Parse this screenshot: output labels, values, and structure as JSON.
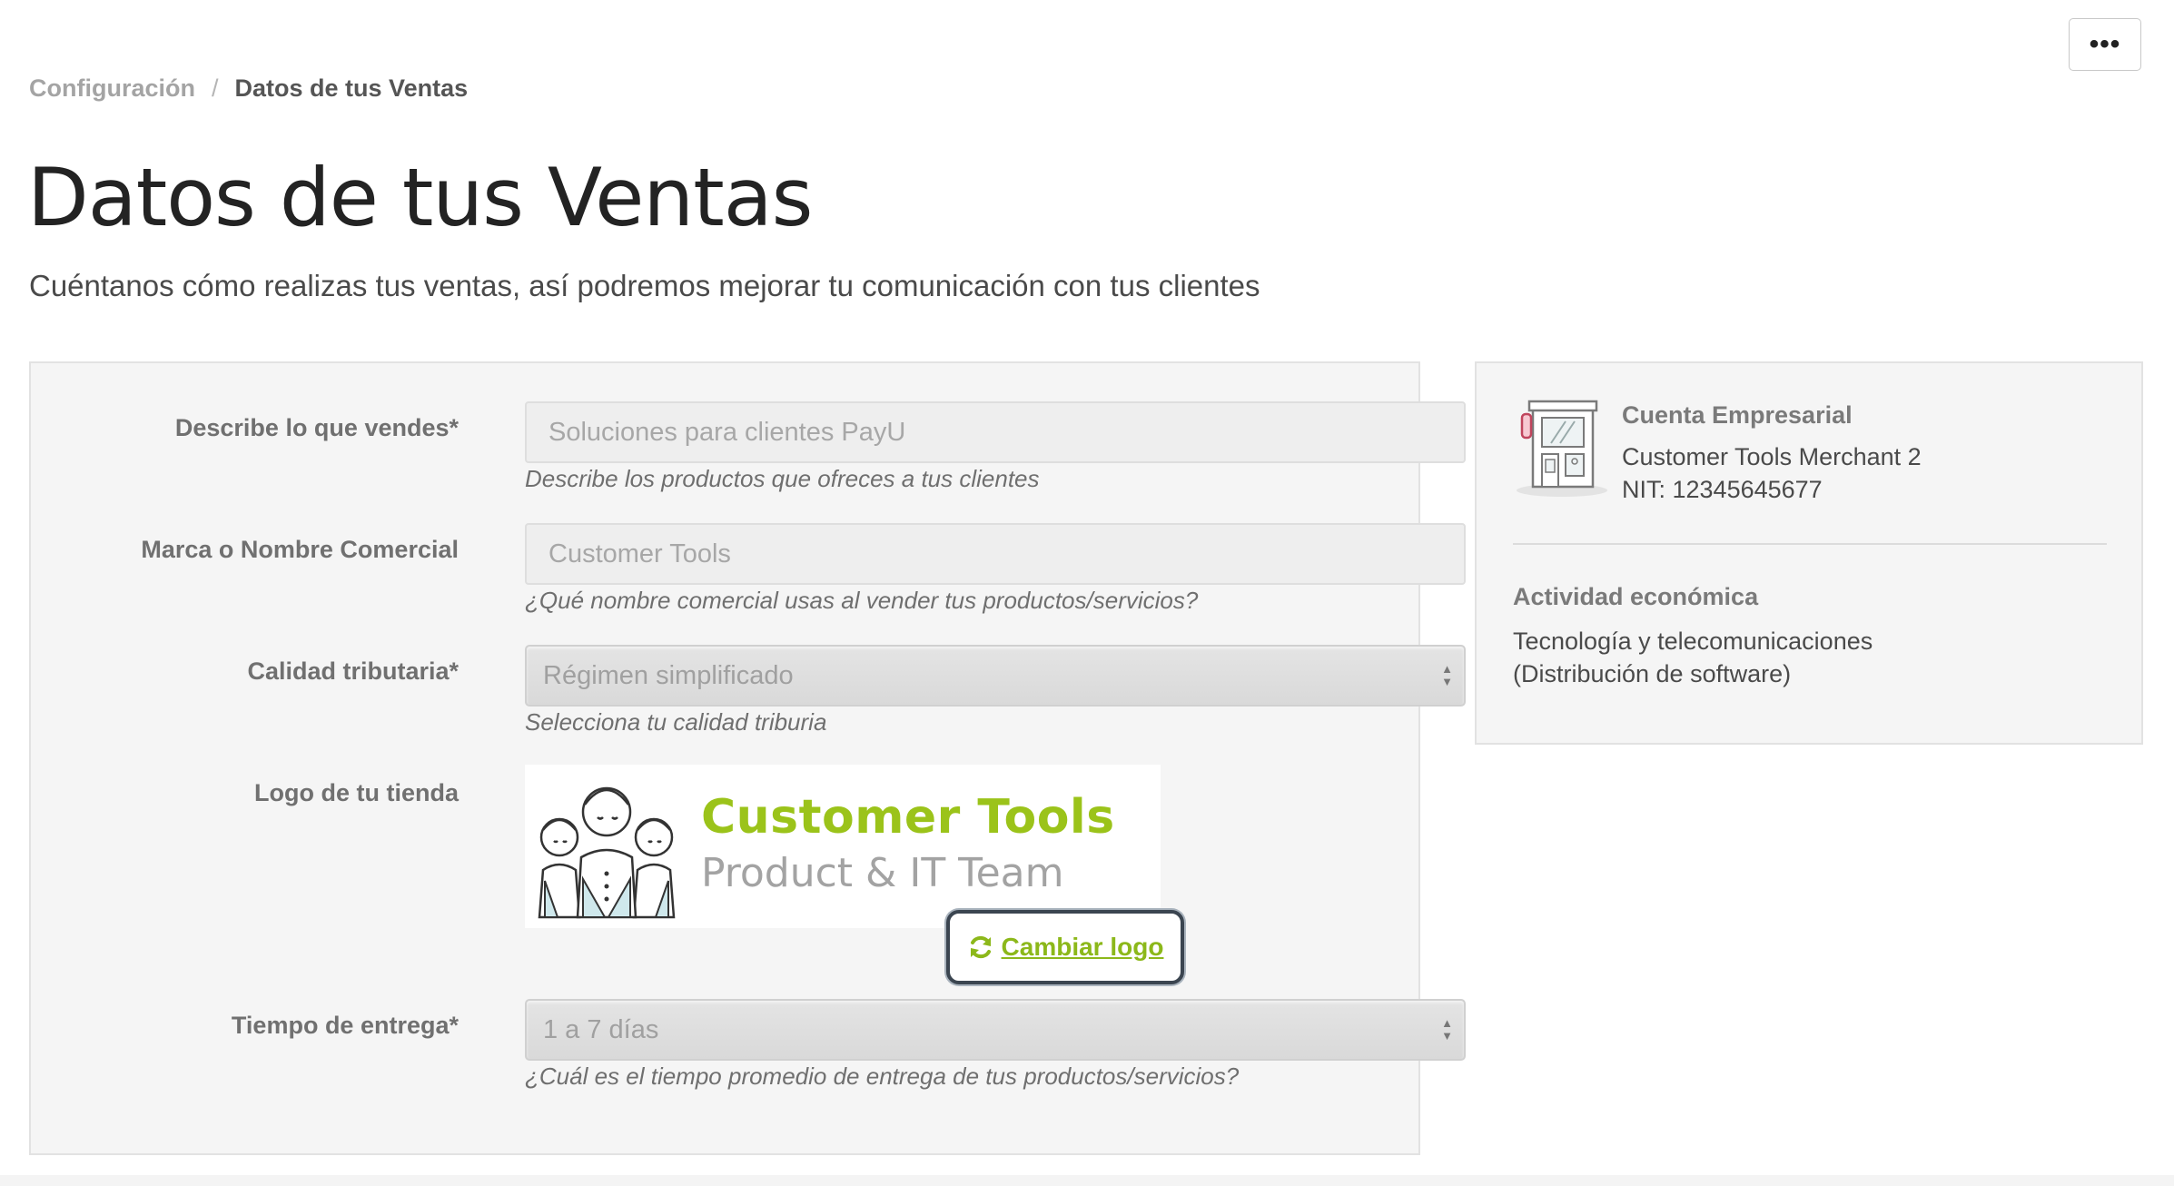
{
  "header": {
    "more_label": "•••",
    "breadcrumb": {
      "parent": "Configuración",
      "separator": "/",
      "current": "Datos de tus Ventas"
    },
    "title": "Datos de tus Ventas",
    "subtitle": "Cuéntanos cómo realizas tus ventas, así podremos mejorar tu comunicación con tus clientes"
  },
  "form": {
    "description": {
      "label": "Describe lo que vendes*",
      "value": "Soluciones para clientes PayU",
      "help": "Describe los productos que ofreces a tus clientes"
    },
    "brand": {
      "label": "Marca o Nombre Comercial",
      "value": "Customer Tools",
      "help": "¿Qué nombre comercial usas al vender tus productos/servicios?"
    },
    "tax_quality": {
      "label": "Calidad tributaria*",
      "value": "Régimen simplificado",
      "help": "Selecciona tu calidad triburia"
    },
    "logo": {
      "label": "Logo de tu tienda",
      "logo_title": "Customer Tools",
      "logo_subtitle": "Product & IT Team",
      "change_label": "Cambiar logo",
      "change_icon": "refresh-icon"
    },
    "delivery_time": {
      "label": "Tiempo de entrega*",
      "value": "1 a 7 días",
      "help": "¿Cuál es el tiempo promedio de entrega de tus productos/servicios?"
    }
  },
  "account": {
    "icon": "store-icon",
    "title": "Cuenta Empresarial",
    "name": "Customer Tools Merchant 2",
    "nit": "NIT: 12345645677",
    "activity_title": "Actividad económica",
    "activity_line1": "Tecnología y telecomunicaciones",
    "activity_line2": "(Distribución de software)"
  },
  "colors": {
    "accent_green": "#9bc31a",
    "panel_bg": "#f5f5f5",
    "title_text": "#232323"
  }
}
